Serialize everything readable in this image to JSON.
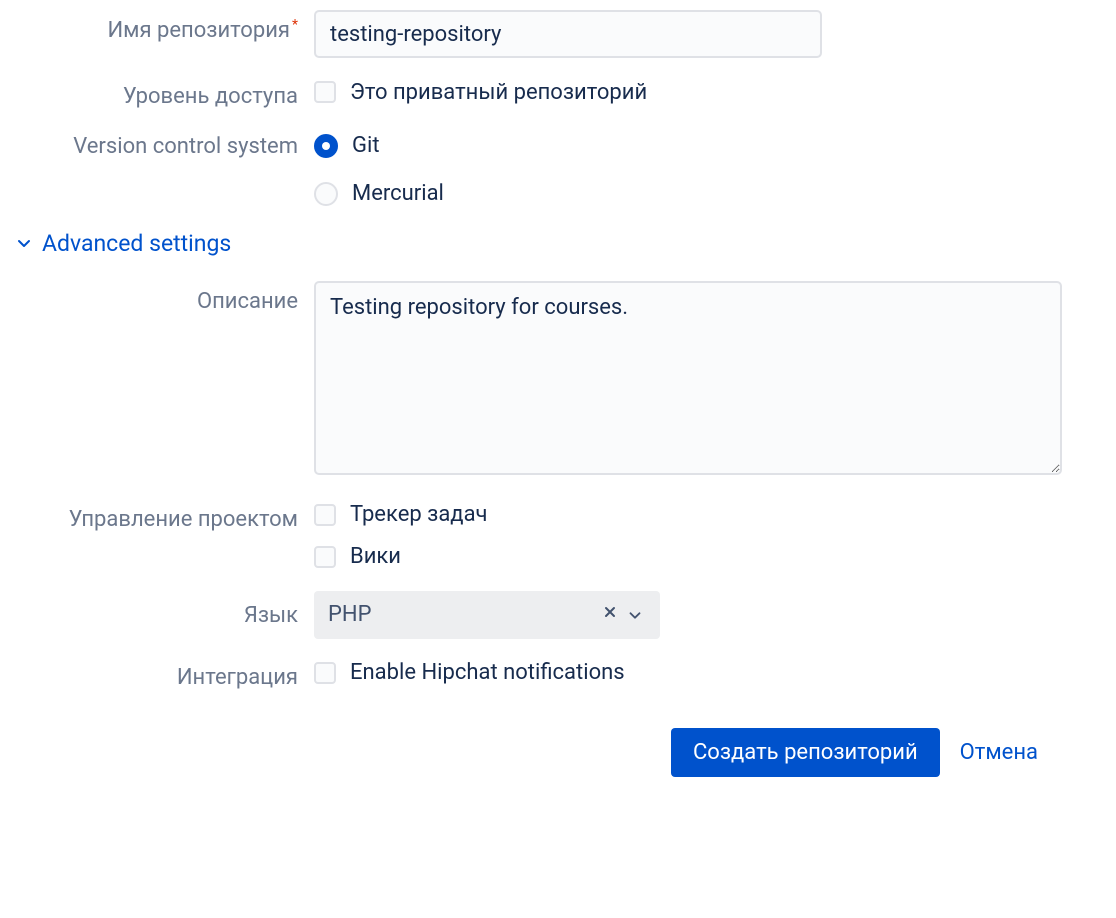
{
  "labels": {
    "repo_name": "Имя репозитория",
    "access_level": "Уровень доступа",
    "vcs": "Version control system",
    "advanced": "Advanced settings",
    "description": "Описание",
    "project_mgmt": "Управление проектом",
    "language": "Язык",
    "integration": "Интеграция"
  },
  "fields": {
    "repo_name_value": "testing-repository",
    "private_label": "Это приватный репозиторий",
    "vcs_git": "Git",
    "vcs_mercurial": "Mercurial",
    "description_value": "Testing repository for courses.",
    "issue_tracker": "Трекер задач",
    "wiki": "Вики",
    "language_value": "PHP",
    "hipchat": "Enable Hipchat notifications"
  },
  "actions": {
    "create": "Создать репозиторий",
    "cancel": "Отмена"
  }
}
